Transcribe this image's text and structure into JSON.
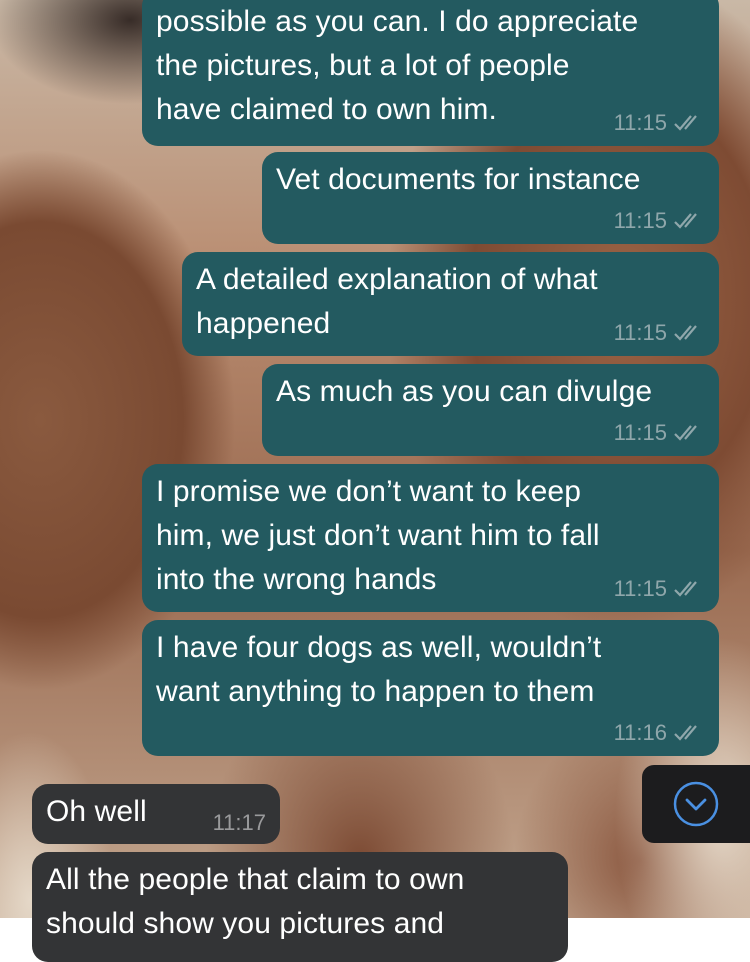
{
  "messages": [
    {
      "direction": "outgoing",
      "text": "possible as you can. I do appreciate\nthe pictures, but a lot of people\nhave claimed to own him.",
      "time": "11:15",
      "status": "read-double-check-icon"
    },
    {
      "direction": "outgoing",
      "text": "Vet documents for instance",
      "time": "11:15",
      "status": "read-double-check-icon"
    },
    {
      "direction": "outgoing",
      "text": "A detailed explanation of what\nhappened",
      "time": "11:15",
      "status": "read-double-check-icon"
    },
    {
      "direction": "outgoing",
      "text": "As much as you can divulge",
      "time": "11:15",
      "status": "read-double-check-icon"
    },
    {
      "direction": "outgoing",
      "text": "I promise we don’t want to keep\nhim, we just don’t want him to fall\ninto the wrong hands",
      "time": "11:15",
      "status": "read-double-check-icon"
    },
    {
      "direction": "outgoing",
      "text": "I have four dogs as well, wouldn’t\nwant anything to happen to them",
      "time": "11:16",
      "status": "read-double-check-icon"
    },
    {
      "direction": "incoming",
      "text": "Oh well",
      "time": "11:17"
    },
    {
      "direction": "incoming",
      "text": "All the people that claim to own\nshould show you pictures and",
      "time": ""
    }
  ],
  "scroll_button": {
    "icon": "chevron-down-circle-icon"
  },
  "colors": {
    "outgoing_bubble": "#235a60",
    "incoming_bubble": "#333436",
    "accent": "#4a90e2"
  }
}
